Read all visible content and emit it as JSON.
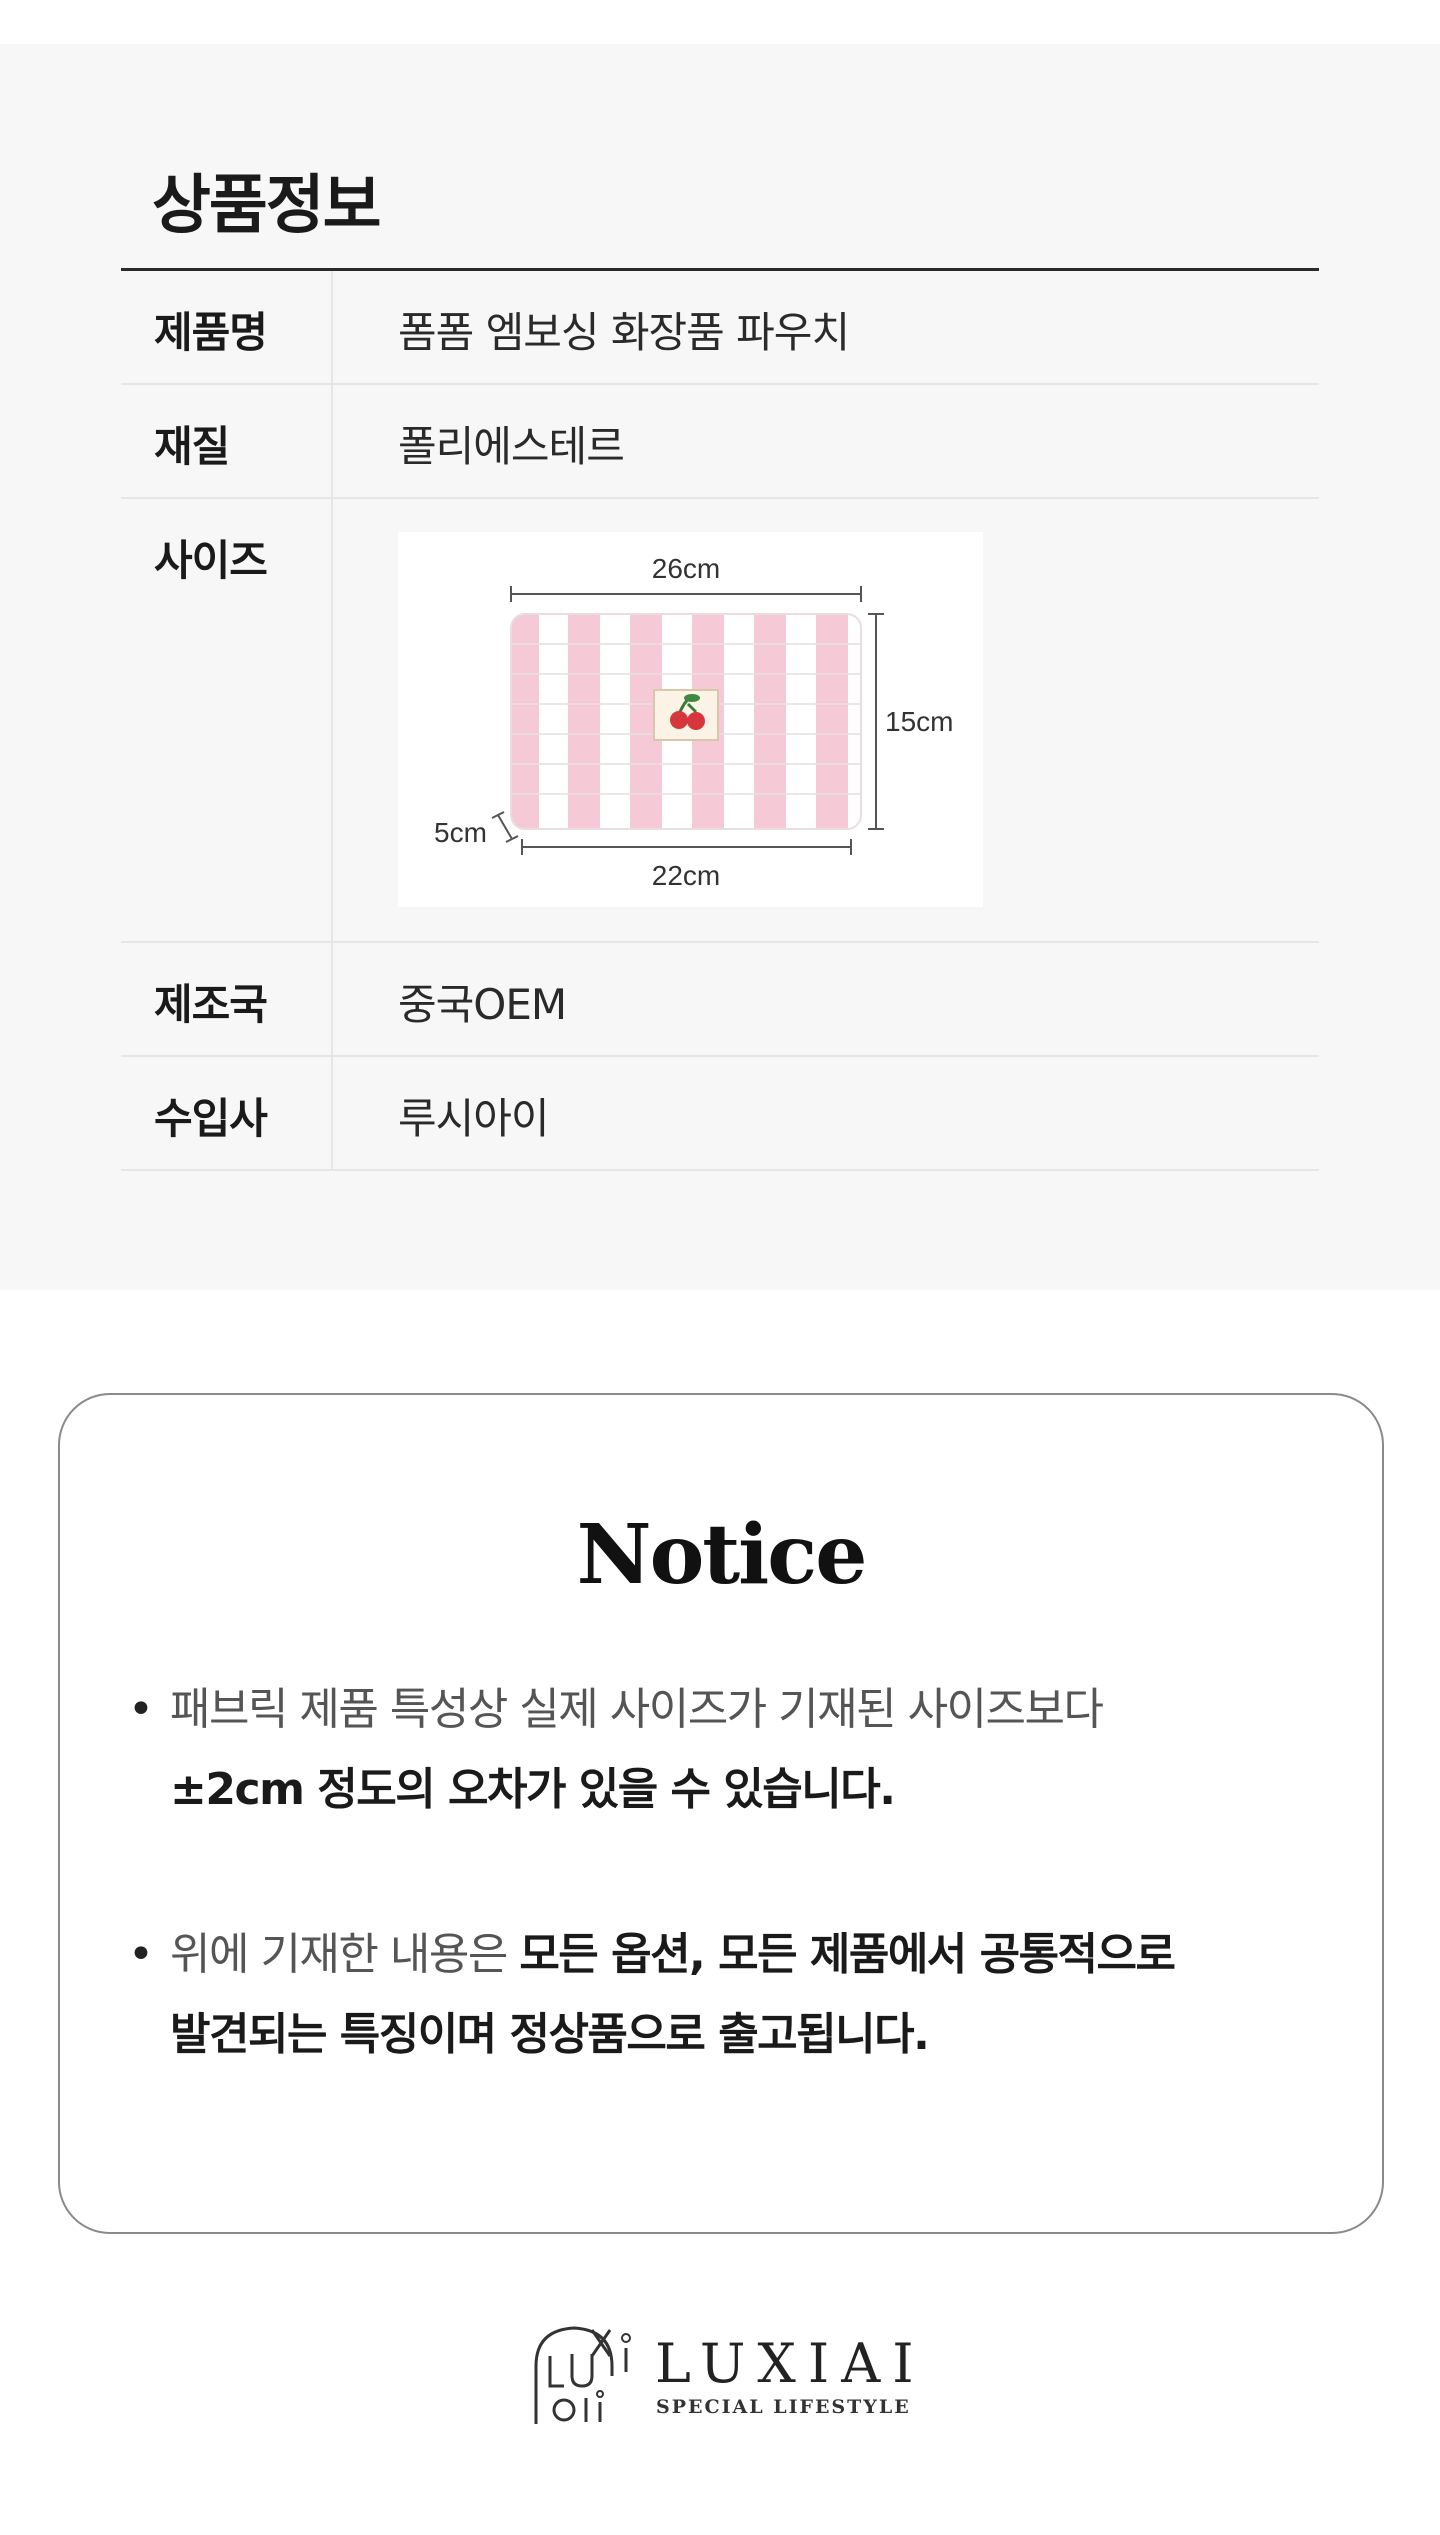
{
  "product_info": {
    "title": "상품정보",
    "rows": [
      {
        "label": "제품명",
        "value": "폼폼 엠보싱 화장품 파우치"
      },
      {
        "label": "재질",
        "value": "폴리에스테르"
      },
      {
        "label": "사이즈",
        "value": ""
      },
      {
        "label": "제조국",
        "value": "중국OEM"
      },
      {
        "label": "수입사",
        "value": "루시아이"
      }
    ],
    "size_image": {
      "top_width": "26cm",
      "height": "15cm",
      "depth": "5cm",
      "bottom_width": "22cm",
      "stripe_colors": [
        "#f6c9d6",
        "#ffffff"
      ]
    }
  },
  "notice": {
    "title": "Notice",
    "bullet1": {
      "line1": "패브릭 제품 특성상 실제 사이즈가 기재된 사이즈보다",
      "line2": "±2cm 정도의 오차가 있을 수 있습니다."
    },
    "bullet2": {
      "line1_light": "위에 기재한 내용은 ",
      "line1_strong": "모든 옵션, 모든 제품에서 공통적으로",
      "line2": "발견되는 특징이며 정상품으로 출고됩니다."
    }
  },
  "brand": {
    "name": "LUXIAI",
    "tagline": "SPECIAL LIFESTYLE"
  }
}
